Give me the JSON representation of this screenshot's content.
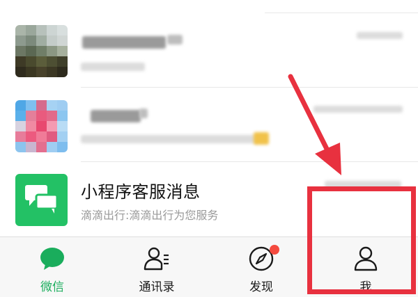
{
  "chats": [
    {
      "title": "",
      "preview": ""
    },
    {
      "title": "",
      "preview": ""
    },
    {
      "title": "小程序客服消息",
      "preview": "滴滴出行:滴滴出行为您服务"
    }
  ],
  "tabs": [
    {
      "label": "微信",
      "icon": "chat-bubble-icon",
      "active": true
    },
    {
      "label": "通讯录",
      "icon": "contacts-icon",
      "active": false
    },
    {
      "label": "发现",
      "icon": "compass-icon",
      "active": false,
      "badge": "red-dot"
    },
    {
      "label": "我",
      "icon": "person-icon",
      "active": false
    }
  ],
  "colors": {
    "accent_green": "#1aad5c",
    "mini_program_green": "#23c165",
    "annotation_red": "#e8313f",
    "badge_red": "#f44a3f"
  }
}
